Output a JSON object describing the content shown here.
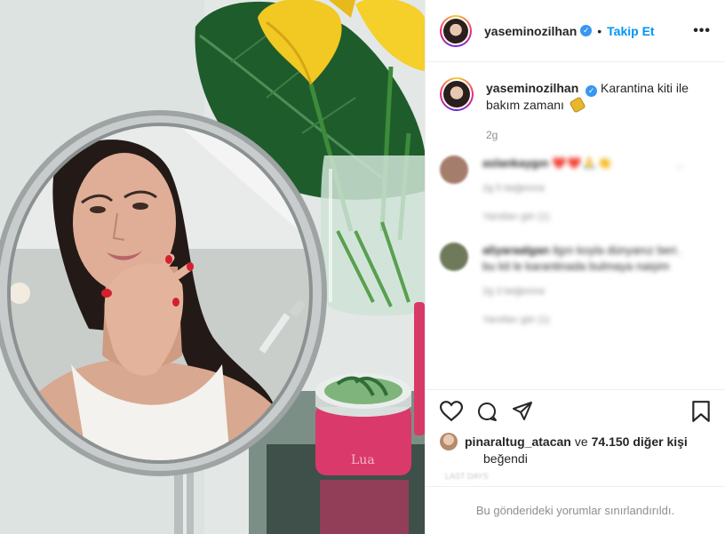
{
  "post": {
    "username": "yaseminozilhan",
    "separator": "•",
    "follow_label": "Takip Et",
    "more_label": "•••",
    "caption_line1": "Karantina kiti ile",
    "caption_line2": "bakım zamanı",
    "time": "2g",
    "photo_jar_label": "Lua"
  },
  "comments": [
    {
      "username": "aslankaygın",
      "text": "❤️❤️🙏👏",
      "likes": "2g  5 beğenme",
      "replies": "Yanıtları gör (1)",
      "avatar_color": "#a57d6d"
    },
    {
      "username": "aliyaraalgan",
      "text": "ilgın koyla dünyanız beri bu kit le karantinada bulmaya naişim",
      "likes": "2g  3 beğenme",
      "replies": "Yanıtları gör (1)",
      "avatar_color": "#6f7a5b"
    }
  ],
  "actions": {
    "liker": "pinaraltug_atacan",
    "connector": "ve",
    "count": "74.150 diğer kişi",
    "liked": "beğendi",
    "faint_text": "LAST DAYS"
  },
  "footer": {
    "notice": "Bu gönderideki yorumlar sınırlandırıldı."
  },
  "colors": {
    "accent": "#0095f6",
    "verified": "#3897f0",
    "border": "#efefef",
    "muted": "#8e8e8e"
  }
}
